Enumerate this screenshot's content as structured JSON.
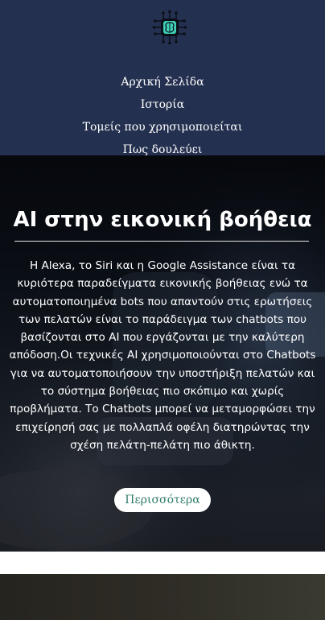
{
  "nav": {
    "logo_icon": "circuit-brain-icon",
    "items": [
      {
        "label": "Αρχική Σελίδα"
      },
      {
        "label": "Ιστορία"
      },
      {
        "label": "Τομείς που χρησιμοποιείται"
      },
      {
        "label": "Πως δουλεύει"
      }
    ]
  },
  "hero": {
    "title": "AI στην εικονική βοήθεια",
    "text": "Η Alexa, το Siri και η Google Assistance είναι τα κυριότερα παραδείγματα εικονικής βοήθειας ενώ τα αυτοματοποιημένα bots που απαντούν στις ερωτήσεις των πελατών είναι το παράδειγμα των chatbots που βασίζονται στο AI που εργάζονται με την καλύτερη απόδοση.Οι τεχνικές AI χρησιμοποιούνται στο Chatbots για να αυτοματοποιήσουν την υποστήριξη πελατών και το σύστημα βοήθειας πιο σκόπιμο και χωρίς προβλήματα. Το Chatbots μπορεί να μεταμορφώσει την επιχείρησή σας με πολλαπλά οφέλη διατηρώντας την σχέση πελάτη-πελάτη πιο άθικτη.",
    "button_label": "Περισσότερα",
    "button_color": "#2f7a6a"
  },
  "colors": {
    "navbar_bg": "#24304f",
    "logo_accent": "#3fd0b8"
  }
}
